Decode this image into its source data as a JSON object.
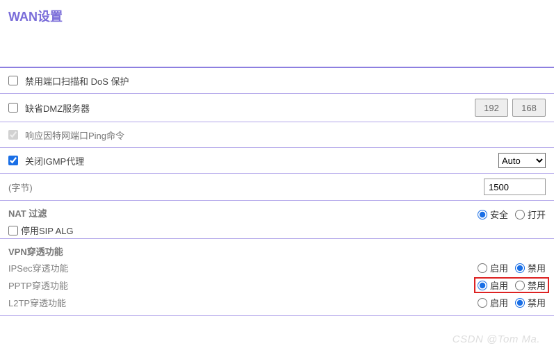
{
  "title": "WAN设置",
  "rows": {
    "portscan": {
      "label": "禁用端口扫描和 DoS 保护",
      "checked": false
    },
    "dmz": {
      "label": "缺省DMZ服务器",
      "checked": false,
      "ip1": "192",
      "ip2": "168"
    },
    "ping": {
      "label": "响应因特网端口Ping命令",
      "checked": true,
      "disabled": true
    },
    "igmp": {
      "label": "关闭IGMP代理",
      "checked": true,
      "select_value": "Auto"
    },
    "mtu": {
      "label": "(字节)",
      "value": "1500"
    }
  },
  "nat": {
    "title": "NAT 过滤",
    "opt1": "安全",
    "opt2": "打开",
    "selected": "opt1",
    "sip": {
      "label": "停用SIP ALG",
      "checked": false
    }
  },
  "vpn": {
    "title": "VPN穿透功能",
    "enable_label": "启用",
    "disable_label": "禁用",
    "ipsec": {
      "label": "IPSec穿透功能",
      "value": "disable"
    },
    "pptp": {
      "label": "PPTP穿透功能",
      "value": "enable",
      "highlight": true
    },
    "l2tp": {
      "label": "L2TP穿透功能",
      "value": "disable"
    }
  },
  "watermark": "CSDN @Tom Ma."
}
